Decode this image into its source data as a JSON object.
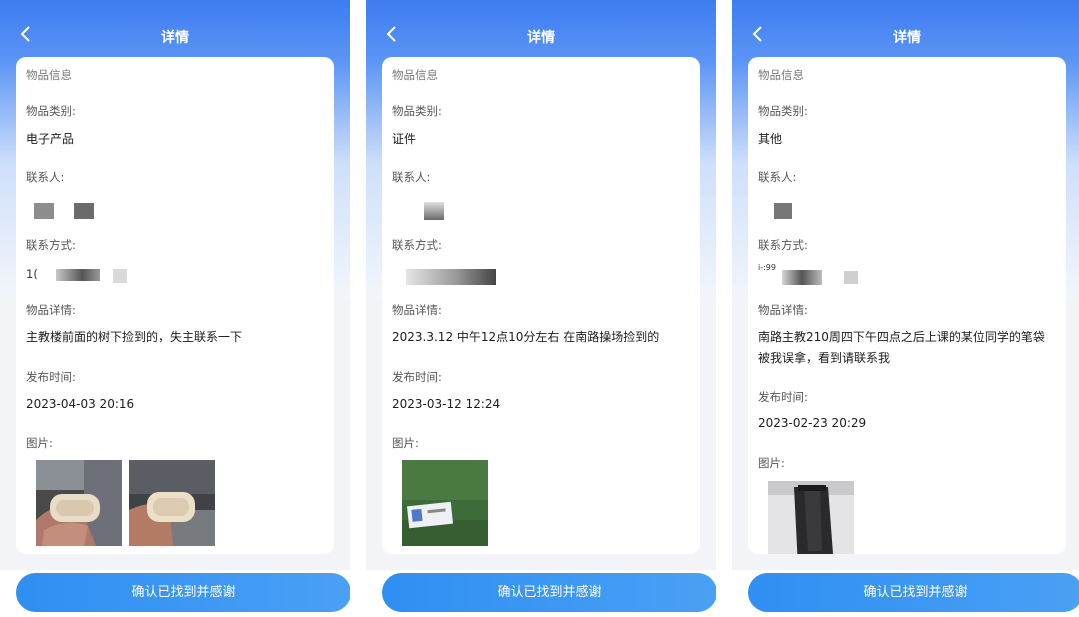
{
  "screens": [
    {
      "title": "详情",
      "section_title": "物品信息",
      "category_label": "物品类别:",
      "category_value": "电子产品",
      "contact_label": "联系人:",
      "method_label": "联系方式:",
      "method_visible_prefix": "1(",
      "detail_label": "物品详情:",
      "detail_value": "主教楼前面的树下捡到的，失主联系一下",
      "time_label": "发布时间:",
      "time_value": "2023-04-03 20:16",
      "image_label": "图片:",
      "image_count": 2,
      "confirm_button": "确认已找到并感谢"
    },
    {
      "title": "详情",
      "section_title": "物品信息",
      "category_label": "物品类别:",
      "category_value": "证件",
      "contact_label": "联系人:",
      "method_label": "联系方式:",
      "detail_label": "物品详情:",
      "detail_value": "2023.3.12 中午12点10分左右 在南路操场捡到的",
      "time_label": "发布时间:",
      "time_value": "2023-03-12 12:24",
      "image_label": "图片:",
      "image_count": 1,
      "confirm_button": "确认已找到并感谢"
    },
    {
      "title": "详情",
      "section_title": "物品信息",
      "category_label": "物品类别:",
      "category_value": "其他",
      "contact_label": "联系人:",
      "method_label": "联系方式:",
      "method_visible_prefix": "i-:99",
      "detail_label": "物品详情:",
      "detail_value": "南路主教210周四下午四点之后上课的某位同学的笔袋被我误拿，看到请联系我",
      "time_label": "发布时间:",
      "time_value": "2023-02-23 20:29",
      "image_label": "图片:",
      "image_count": 1,
      "confirm_button": "确认已找到并感谢"
    }
  ],
  "colors": {
    "header_blue": "#3d7df2",
    "button_blue": "#2f8ff2",
    "page_bg": "#f2f4f8",
    "card_bg": "#ffffff"
  },
  "icons": [
    "chevron-left-icon"
  ]
}
